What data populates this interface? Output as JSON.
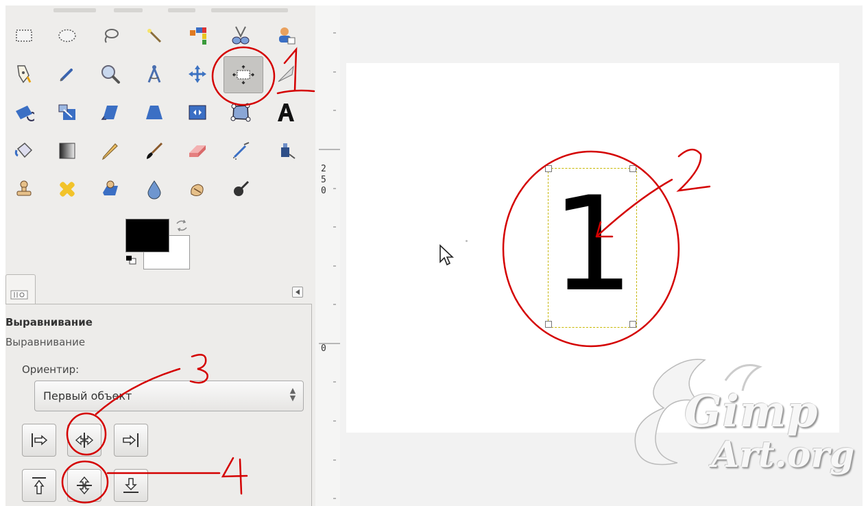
{
  "tool_options": {
    "title": "Выравнивание",
    "subtitle": "Выравнивание",
    "relative_to_label": "Ориентир:",
    "relative_to_value": "Первый объект"
  },
  "ruler": {
    "labels": [
      "2",
      "5",
      "0",
      "0"
    ]
  },
  "canvas": {
    "layer_text": "1"
  },
  "annotations": {
    "label_1": "1",
    "label_2": "2",
    "label_3": "3",
    "label_4": "4",
    "color": "#d40000"
  },
  "watermark": {
    "main": "Gimp",
    "sub": "Art.org"
  },
  "colors": {
    "foreground": "#000000",
    "background": "#ffffff",
    "active_tool_bg": "#c6c5c2"
  },
  "tools": [
    "rect-select",
    "ellipse-select",
    "free-select",
    "fuzzy-select",
    "select-by-color",
    "scissors-select",
    "foreground-select",
    "paths",
    "color-picker",
    "zoom",
    "measure",
    "move",
    "alignment",
    "crop",
    "rotate",
    "scale",
    "shear",
    "perspective",
    "flip",
    "cage-transform",
    "text",
    "bucket-fill",
    "blend",
    "pencil",
    "paintbrush",
    "eraser",
    "airbrush",
    "ink",
    "clone",
    "heal",
    "perspective-clone",
    "blur-sharpen",
    "smudge",
    "dodge-burn"
  ]
}
